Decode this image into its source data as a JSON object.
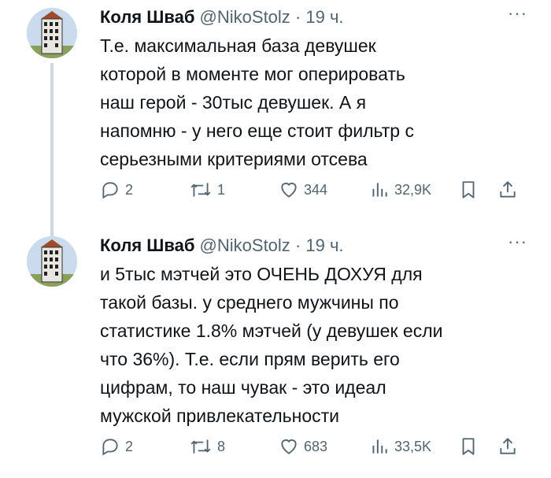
{
  "tweets": [
    {
      "author_name": "Коля Шваб",
      "handle": "@NikoStolz",
      "separator": "·",
      "time": "19 ч.",
      "more": "···",
      "lines": [
        "Т.е. максимальная база девушек",
        "которой в моменте мог оперировать",
        "наш герой - 30тыс девушек. А я",
        "напомню - у него еще стоит фильтр с",
        "серьезными критериями отсева"
      ],
      "replies": "2",
      "retweets": "1",
      "likes": "344",
      "views": "32,9K"
    },
    {
      "author_name": "Коля Шваб",
      "handle": "@NikoStolz",
      "separator": "·",
      "time": "19 ч.",
      "more": "···",
      "lines": [
        "и 5тыс мэтчей это ОЧЕНЬ ДОХУЯ для",
        "такой базы. у среднего мужчины по",
        "статистике 1.8% мэтчей (у девушек если",
        "что 36%). Т.е. если прям верить его",
        "цифрам, то наш чувак - это идеал",
        "мужской привлекательности"
      ],
      "replies": "2",
      "retweets": "8",
      "likes": "683",
      "views": "33,5K"
    }
  ],
  "icons": {
    "reply": "reply-icon",
    "retweet": "retweet-icon",
    "like": "heart-icon",
    "views": "views-icon",
    "bookmark": "bookmark-icon",
    "share": "share-icon"
  },
  "colors": {
    "text": "#0f1419",
    "secondary": "#536471",
    "thread_line": "#cfd9de"
  }
}
